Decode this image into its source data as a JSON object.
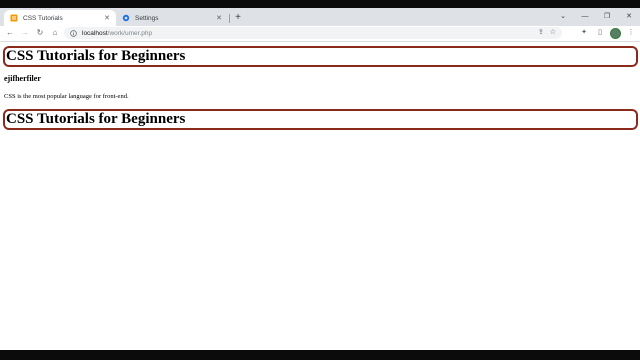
{
  "browser": {
    "tabs": [
      {
        "title": "CSS Tutorials",
        "icon": "html-file-icon",
        "active": true
      },
      {
        "title": "Settings",
        "icon": "gear-icon",
        "active": false
      }
    ],
    "new_tab": "+",
    "tab_close": "✕",
    "url_host": "localhost",
    "url_path": "/work/umer.php"
  },
  "page": {
    "heading_top": "CSS Tutorials for Beginners",
    "subheading": "ejifherfiler",
    "paragraph": "CSS is the most popular language for front-end.",
    "heading_bottom": "CSS Tutorials for Beginners"
  },
  "colors": {
    "heading_border": "#8b2a1b",
    "chrome_bg": "#dee1e6",
    "active_tab_favicon": "#f29900",
    "settings_icon": "#1a73e8"
  }
}
